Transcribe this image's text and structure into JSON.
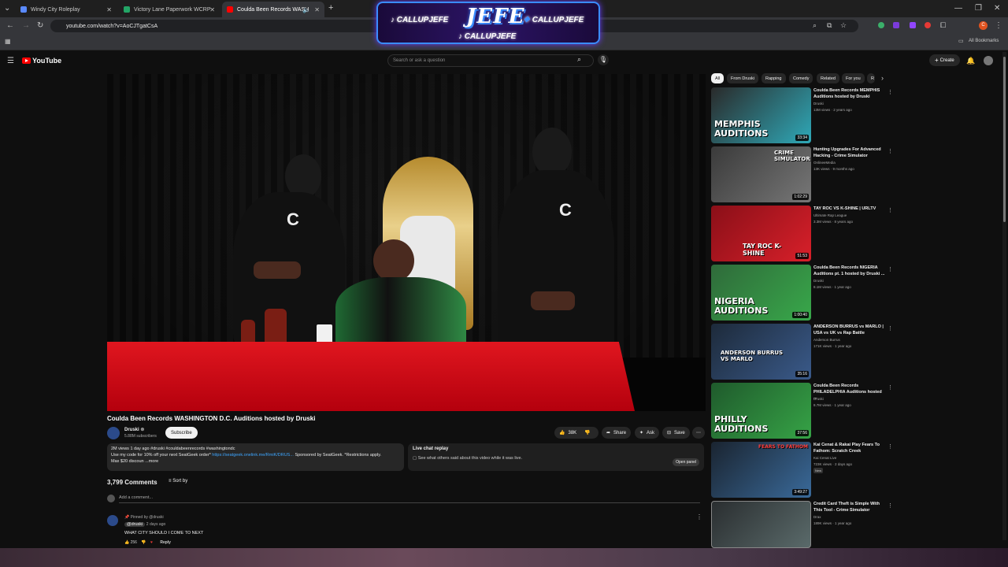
{
  "browser": {
    "tabs": [
      {
        "title": "Windy City Roleplay",
        "fav_color": "#5a8aff",
        "active": false
      },
      {
        "title": "Victory Lane Paperwork WCRP",
        "fav_color": "#23a566",
        "active": false
      },
      {
        "title": "Coulda Been Records WASH",
        "fav_color": "#ff0000",
        "active": true
      }
    ],
    "new_tab_label": "+",
    "url": "youtube.com/watch?v=AoCJTgatCsA",
    "all_bookmarks": "All Bookmarks",
    "profile_initial": "C"
  },
  "banner": {
    "jefe": "JEFE",
    "handle_left": "CALLUPJEFE",
    "handle_right": "CALLUPJEFE",
    "handle_bottom": "CALLUPJEFE"
  },
  "youtube": {
    "logo": "YouTube",
    "search_placeholder": "Search or ask a question",
    "create": "Create"
  },
  "video": {
    "title": "Coulda Been Records WASHINGTON D.C. Auditions hosted by Druski",
    "channel": "Druski",
    "subscribers": "5.88M subscribers",
    "subscribe": "Subscribe",
    "likes": "38K",
    "share": "Share",
    "ask": "Ask",
    "save": "Save",
    "desc_meta": "2M views  1 day ago  #druski #couldabeenrecords #washingtondc",
    "desc_line2_a": "Use my code for 10% off your next SeatGeek order* ",
    "desc_link": "https://seatgeek.onelink.me/RmiK/DRUS...",
    "desc_line2_b": " Sponsored by SeatGeek. *Restrictions apply.",
    "desc_line3": "Max $20 discoun",
    "desc_more": "...more",
    "live_chat_title": "Live chat replay",
    "live_chat_sub": "See what others said about this video while it was live.",
    "open_panel": "Open panel"
  },
  "comments": {
    "count": "3,799 Comments",
    "sort": "Sort by",
    "add": "Add a comment...",
    "pinned": "Pinned by @druski",
    "author": "@druski",
    "time": "2 days ago",
    "text": "WHAT CITY SHOULD I COME TO NEXT",
    "likes": "256",
    "reply": "Reply"
  },
  "chips": [
    "All",
    "From Druski",
    "Rapping",
    "Comedy",
    "Related",
    "For you",
    "R"
  ],
  "recommendations": [
    {
      "title": "Coulda Been Records MEMPHIS Auditions hosted by Druski",
      "channel": "Druski",
      "views": "13M views · 2 years ago",
      "duration": "33:34",
      "thumb_text": "MEMPHIS AUDITIONS",
      "bg": "#2a2a2a",
      "accent": "#2fa9b8"
    },
    {
      "title": "Hunting Upgrades For Advanced Hacking - Crime Simulator",
      "channel": "OnlineeMedia",
      "views": "13K views · 9 months ago",
      "duration": "1:02:29",
      "thumb_text": "CRIME SIMULATOR",
      "bg": "#3a3a3a",
      "accent": "#777777"
    },
    {
      "title": "TAY ROC VS K-SHINE | URLTV",
      "channel": "Ultimate Rap League",
      "views": "3.3M views · 8 years ago",
      "duration": "51:53",
      "thumb_text": "TAY ROC K-SHINE",
      "bg": "#8a0f18",
      "accent": "#d8202a"
    },
    {
      "title": "Coulda Been Records NIGERIA Auditions pt. 1 hosted by Druski ...",
      "channel": "Druski",
      "views": "8.1M views · 1 year ago",
      "duration": "1:00:40",
      "thumb_text": "NIGERIA AUDITIONS",
      "bg": "#2f6a3a",
      "accent": "#38a84a"
    },
    {
      "title": "ANDERSON BURRUS vs MARLO | USA vs UK vs Rap Battle",
      "channel": "Anderson Burrus",
      "views": "171K views · 1 year ago",
      "duration": "35:16",
      "thumb_text": "ANDERSON BURRUS VS MARLO",
      "bg": "#1d2a3a",
      "accent": "#3a5a8a"
    },
    {
      "title": "Coulda Been Records PHILADELPHIA Auditions hosted ...",
      "channel": "Druski",
      "views": "8.7M views · 1 year ago",
      "duration": "37:56",
      "thumb_text": "PHILLY AUDITIONS",
      "bg": "#1f5a2c",
      "accent": "#36a346"
    },
    {
      "title": "Kai Cenat & Rakai Play Fears To Fathom: Scratch Creek",
      "channel": "Kai Cenat Live",
      "views": "723K views · 2 days ago",
      "duration": "3:49:27",
      "thumb_text": "FEARS TO FATHOM",
      "bg": "#1a2430",
      "accent": "#3a6a9a",
      "badge": "New"
    },
    {
      "title": "Credit Card Theft is Simple With This Tool - Crime Simulator",
      "channel": "Drax",
      "views": "189K views · 1 year ago",
      "duration": "",
      "thumb_text": "",
      "bg": "#2a2e30",
      "accent": "#5a6a6a"
    }
  ]
}
